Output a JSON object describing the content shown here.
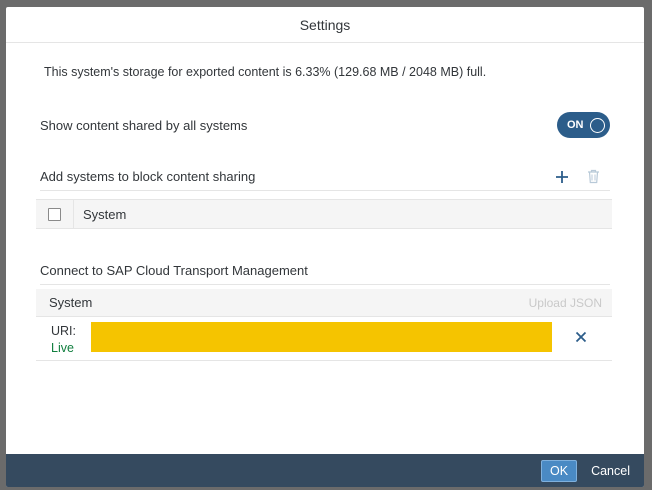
{
  "dialog": {
    "title": "Settings",
    "storage_text": "This system's storage for exported content is 6.33% (129.68 MB / 2048 MB) full.",
    "show_shared_label": "Show content shared by all systems",
    "show_shared_toggle": "ON",
    "block_label": "Add systems to block content sharing",
    "block_table": {
      "columns": [
        "System"
      ],
      "rows": []
    },
    "connect_label": "Connect to SAP Cloud Transport Management",
    "transport_table": {
      "column": "System",
      "upload_label": "Upload JSON",
      "rows": [
        {
          "uri_label": "URI:",
          "status": "Live"
        }
      ]
    }
  },
  "footer": {
    "ok_label": "OK",
    "cancel_label": "Cancel"
  },
  "colors": {
    "accent": "#2c5d8a",
    "footer": "#354a5f",
    "ok_button": "#4a8ac4",
    "live_status": "#107e3e",
    "redaction": "#f5c400"
  },
  "icons": [
    "add-icon",
    "trash-icon",
    "close-icon",
    "toggle-knob-icon"
  ]
}
